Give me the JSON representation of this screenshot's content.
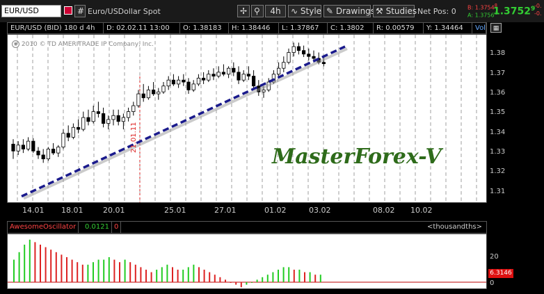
{
  "toolbar": {
    "symbol": "EUR/USD",
    "hash_label": "#",
    "description": "Euro/USDollar Spot",
    "interval": "4h",
    "style_label": "Style",
    "drawings_label": "Drawings",
    "studies_label": "Studies",
    "netpos_label": "Net Pos: 0",
    "bid_label": "B: 1.3754",
    "ask_label": "A: 1.3756",
    "bid_super": "8",
    "ask_super": "4",
    "last_main": "1.3752",
    "last_super": "9",
    "change_top": "-0.",
    "change_bottom": "-0."
  },
  "infobar": {
    "title": "EUR/USD (BID) 180 d 4h",
    "date": "D: 02.02.11 13:00",
    "open": "O: 1.38183",
    "high": "H: 1.38446",
    "low": "L: 1.37867",
    "close": "C: 1.3802",
    "range": "R: 0.00579",
    "y": "Y: 1.34464",
    "study": "VolumeProfile (AU..."
  },
  "copyright": "2010 © TD AMERITRADE IP Company, Inc.",
  "watermark": "MasterForex-V",
  "vline_label": "21.01.11",
  "price_axis": [
    "1.38",
    "1.37",
    "1.36",
    "1.35",
    "1.34",
    "1.33",
    "1.32",
    "1.31"
  ],
  "date_axis": [
    "14.01",
    "18.01",
    "20.01",
    "25.01",
    "27.01",
    "01.02",
    "03.02",
    "08.02",
    "10.02"
  ],
  "oscillator": {
    "name": "AwesomeOscillator",
    "value": "0.0121",
    "zero": "0",
    "units": "<thousandths>",
    "axis": [
      "20",
      "0"
    ],
    "current": "6.3146"
  },
  "colors": {
    "up_bar": "#22cc22",
    "down_bar": "#dd2222",
    "trendline": "#1a1a8c",
    "watermark": "#2e6b1a",
    "vline": "#dd2222"
  },
  "chart_data": {
    "type": "candlestick",
    "ylim": [
      1.305,
      1.39
    ],
    "candles": [
      [
        1.3345,
        1.337,
        1.327,
        1.331
      ],
      [
        1.331,
        1.336,
        1.329,
        1.334
      ],
      [
        1.334,
        1.337,
        1.33,
        1.332
      ],
      [
        1.332,
        1.338,
        1.331,
        1.336
      ],
      [
        1.336,
        1.3375,
        1.33,
        1.331
      ],
      [
        1.331,
        1.333,
        1.327,
        1.329
      ],
      [
        1.329,
        1.332,
        1.325,
        1.327
      ],
      [
        1.327,
        1.333,
        1.326,
        1.332
      ],
      [
        1.332,
        1.335,
        1.329,
        1.33
      ],
      [
        1.33,
        1.334,
        1.328,
        1.333
      ],
      [
        1.333,
        1.342,
        1.332,
        1.34
      ],
      [
        1.34,
        1.344,
        1.336,
        1.338
      ],
      [
        1.338,
        1.345,
        1.337,
        1.343
      ],
      [
        1.343,
        1.347,
        1.34,
        1.342
      ],
      [
        1.342,
        1.351,
        1.341,
        1.348
      ],
      [
        1.348,
        1.352,
        1.344,
        1.346
      ],
      [
        1.346,
        1.354,
        1.345,
        1.351
      ],
      [
        1.351,
        1.356,
        1.348,
        1.35
      ],
      [
        1.35,
        1.353,
        1.343,
        1.345
      ],
      [
        1.345,
        1.349,
        1.342,
        1.347
      ],
      [
        1.347,
        1.352,
        1.344,
        1.349
      ],
      [
        1.349,
        1.352,
        1.344,
        1.346
      ],
      [
        1.346,
        1.35,
        1.342,
        1.348
      ],
      [
        1.348,
        1.353,
        1.346,
        1.351
      ],
      [
        1.351,
        1.356,
        1.349,
        1.354
      ],
      [
        1.354,
        1.362,
        1.353,
        1.36
      ],
      [
        1.36,
        1.365,
        1.356,
        1.358
      ],
      [
        1.358,
        1.364,
        1.357,
        1.362
      ],
      [
        1.362,
        1.366,
        1.359,
        1.36
      ],
      [
        1.36,
        1.363,
        1.357,
        1.361
      ],
      [
        1.361,
        1.366,
        1.36,
        1.364
      ],
      [
        1.364,
        1.369,
        1.362,
        1.367
      ],
      [
        1.367,
        1.37,
        1.364,
        1.365
      ],
      [
        1.365,
        1.369,
        1.363,
        1.367
      ],
      [
        1.367,
        1.37,
        1.364,
        1.366
      ],
      [
        1.366,
        1.368,
        1.36,
        1.362
      ],
      [
        1.362,
        1.367,
        1.361,
        1.365
      ],
      [
        1.365,
        1.37,
        1.364,
        1.368
      ],
      [
        1.368,
        1.371,
        1.365,
        1.367
      ],
      [
        1.367,
        1.372,
        1.366,
        1.37
      ],
      [
        1.37,
        1.373,
        1.367,
        1.369
      ],
      [
        1.369,
        1.374,
        1.368,
        1.371
      ],
      [
        1.371,
        1.375,
        1.369,
        1.37
      ],
      [
        1.37,
        1.374,
        1.368,
        1.373
      ],
      [
        1.373,
        1.376,
        1.369,
        1.371
      ],
      [
        1.371,
        1.374,
        1.365,
        1.367
      ],
      [
        1.367,
        1.372,
        1.366,
        1.37
      ],
      [
        1.37,
        1.374,
        1.367,
        1.369
      ],
      [
        1.369,
        1.372,
        1.362,
        1.364
      ],
      [
        1.364,
        1.367,
        1.359,
        1.361
      ],
      [
        1.361,
        1.364,
        1.358,
        1.362
      ],
      [
        1.362,
        1.368,
        1.361,
        1.366
      ],
      [
        1.366,
        1.372,
        1.365,
        1.37
      ],
      [
        1.37,
        1.376,
        1.369,
        1.373
      ],
      [
        1.373,
        1.379,
        1.371,
        1.376
      ],
      [
        1.376,
        1.383,
        1.375,
        1.381
      ],
      [
        1.381,
        1.386,
        1.379,
        1.384
      ],
      [
        1.384,
        1.386,
        1.38,
        1.382
      ],
      [
        1.382,
        1.3845,
        1.3787,
        1.3802
      ],
      [
        1.3802,
        1.383,
        1.377,
        1.379
      ],
      [
        1.379,
        1.382,
        1.376,
        1.378
      ],
      [
        1.378,
        1.381,
        1.375,
        1.376
      ],
      [
        1.376,
        1.379,
        1.374,
        1.3753
      ]
    ],
    "trendline": [
      [
        1.308,
        0
      ],
      [
        1.384,
        1
      ]
    ],
    "ao": [
      9,
      12,
      15,
      17,
      16,
      15,
      14,
      13,
      12,
      11,
      10,
      9,
      8,
      7,
      7,
      8,
      9,
      9,
      10,
      9,
      8,
      9,
      8,
      7,
      6,
      5,
      4,
      5,
      6,
      7,
      6,
      5,
      5,
      6,
      7,
      6,
      5,
      4,
      3,
      2,
      1,
      0,
      -1,
      -2,
      -1,
      0,
      1,
      2,
      3,
      4,
      5,
      6,
      6,
      5,
      5,
      4,
      4,
      3,
      3
    ]
  }
}
